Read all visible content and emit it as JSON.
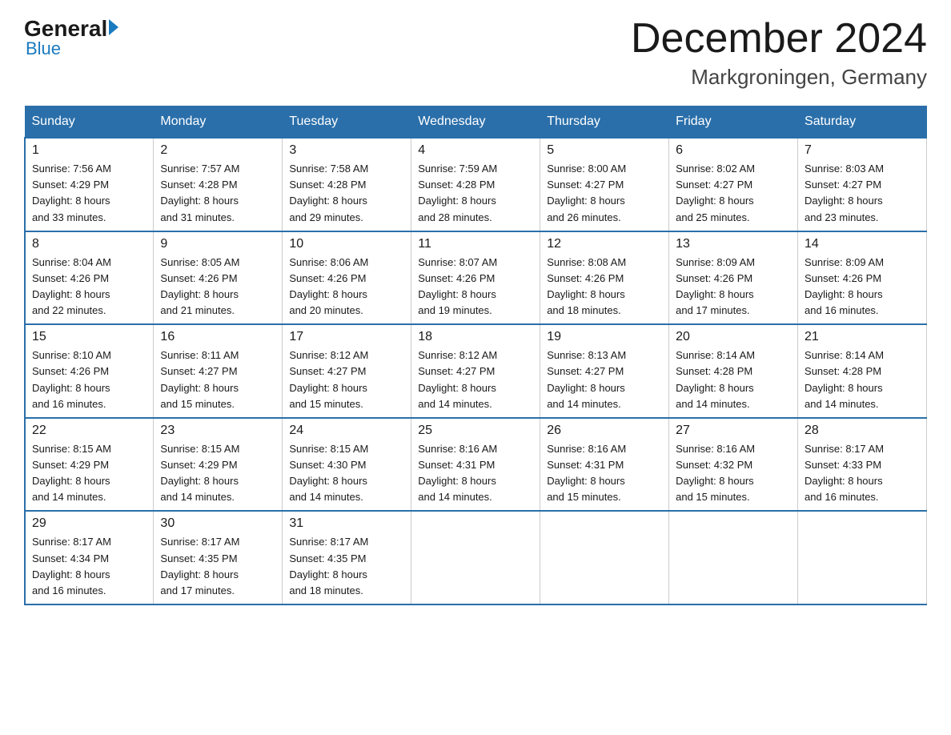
{
  "logo": {
    "general": "General",
    "blue": "Blue",
    "subtitle": "Blue"
  },
  "title": "December 2024",
  "subtitle": "Markgroningen, Germany",
  "columns": [
    "Sunday",
    "Monday",
    "Tuesday",
    "Wednesday",
    "Thursday",
    "Friday",
    "Saturday"
  ],
  "weeks": [
    [
      {
        "day": "1",
        "sunrise": "7:56 AM",
        "sunset": "4:29 PM",
        "daylight": "8 hours and 33 minutes."
      },
      {
        "day": "2",
        "sunrise": "7:57 AM",
        "sunset": "4:28 PM",
        "daylight": "8 hours and 31 minutes."
      },
      {
        "day": "3",
        "sunrise": "7:58 AM",
        "sunset": "4:28 PM",
        "daylight": "8 hours and 29 minutes."
      },
      {
        "day": "4",
        "sunrise": "7:59 AM",
        "sunset": "4:28 PM",
        "daylight": "8 hours and 28 minutes."
      },
      {
        "day": "5",
        "sunrise": "8:00 AM",
        "sunset": "4:27 PM",
        "daylight": "8 hours and 26 minutes."
      },
      {
        "day": "6",
        "sunrise": "8:02 AM",
        "sunset": "4:27 PM",
        "daylight": "8 hours and 25 minutes."
      },
      {
        "day": "7",
        "sunrise": "8:03 AM",
        "sunset": "4:27 PM",
        "daylight": "8 hours and 23 minutes."
      }
    ],
    [
      {
        "day": "8",
        "sunrise": "8:04 AM",
        "sunset": "4:26 PM",
        "daylight": "8 hours and 22 minutes."
      },
      {
        "day": "9",
        "sunrise": "8:05 AM",
        "sunset": "4:26 PM",
        "daylight": "8 hours and 21 minutes."
      },
      {
        "day": "10",
        "sunrise": "8:06 AM",
        "sunset": "4:26 PM",
        "daylight": "8 hours and 20 minutes."
      },
      {
        "day": "11",
        "sunrise": "8:07 AM",
        "sunset": "4:26 PM",
        "daylight": "8 hours and 19 minutes."
      },
      {
        "day": "12",
        "sunrise": "8:08 AM",
        "sunset": "4:26 PM",
        "daylight": "8 hours and 18 minutes."
      },
      {
        "day": "13",
        "sunrise": "8:09 AM",
        "sunset": "4:26 PM",
        "daylight": "8 hours and 17 minutes."
      },
      {
        "day": "14",
        "sunrise": "8:09 AM",
        "sunset": "4:26 PM",
        "daylight": "8 hours and 16 minutes."
      }
    ],
    [
      {
        "day": "15",
        "sunrise": "8:10 AM",
        "sunset": "4:26 PM",
        "daylight": "8 hours and 16 minutes."
      },
      {
        "day": "16",
        "sunrise": "8:11 AM",
        "sunset": "4:27 PM",
        "daylight": "8 hours and 15 minutes."
      },
      {
        "day": "17",
        "sunrise": "8:12 AM",
        "sunset": "4:27 PM",
        "daylight": "8 hours and 15 minutes."
      },
      {
        "day": "18",
        "sunrise": "8:12 AM",
        "sunset": "4:27 PM",
        "daylight": "8 hours and 14 minutes."
      },
      {
        "day": "19",
        "sunrise": "8:13 AM",
        "sunset": "4:27 PM",
        "daylight": "8 hours and 14 minutes."
      },
      {
        "day": "20",
        "sunrise": "8:14 AM",
        "sunset": "4:28 PM",
        "daylight": "8 hours and 14 minutes."
      },
      {
        "day": "21",
        "sunrise": "8:14 AM",
        "sunset": "4:28 PM",
        "daylight": "8 hours and 14 minutes."
      }
    ],
    [
      {
        "day": "22",
        "sunrise": "8:15 AM",
        "sunset": "4:29 PM",
        "daylight": "8 hours and 14 minutes."
      },
      {
        "day": "23",
        "sunrise": "8:15 AM",
        "sunset": "4:29 PM",
        "daylight": "8 hours and 14 minutes."
      },
      {
        "day": "24",
        "sunrise": "8:15 AM",
        "sunset": "4:30 PM",
        "daylight": "8 hours and 14 minutes."
      },
      {
        "day": "25",
        "sunrise": "8:16 AM",
        "sunset": "4:31 PM",
        "daylight": "8 hours and 14 minutes."
      },
      {
        "day": "26",
        "sunrise": "8:16 AM",
        "sunset": "4:31 PM",
        "daylight": "8 hours and 15 minutes."
      },
      {
        "day": "27",
        "sunrise": "8:16 AM",
        "sunset": "4:32 PM",
        "daylight": "8 hours and 15 minutes."
      },
      {
        "day": "28",
        "sunrise": "8:17 AM",
        "sunset": "4:33 PM",
        "daylight": "8 hours and 16 minutes."
      }
    ],
    [
      {
        "day": "29",
        "sunrise": "8:17 AM",
        "sunset": "4:34 PM",
        "daylight": "8 hours and 16 minutes."
      },
      {
        "day": "30",
        "sunrise": "8:17 AM",
        "sunset": "4:35 PM",
        "daylight": "8 hours and 17 minutes."
      },
      {
        "day": "31",
        "sunrise": "8:17 AM",
        "sunset": "4:35 PM",
        "daylight": "8 hours and 18 minutes."
      },
      null,
      null,
      null,
      null
    ]
  ],
  "labels": {
    "sunrise": "Sunrise:",
    "sunset": "Sunset:",
    "daylight": "Daylight:"
  }
}
